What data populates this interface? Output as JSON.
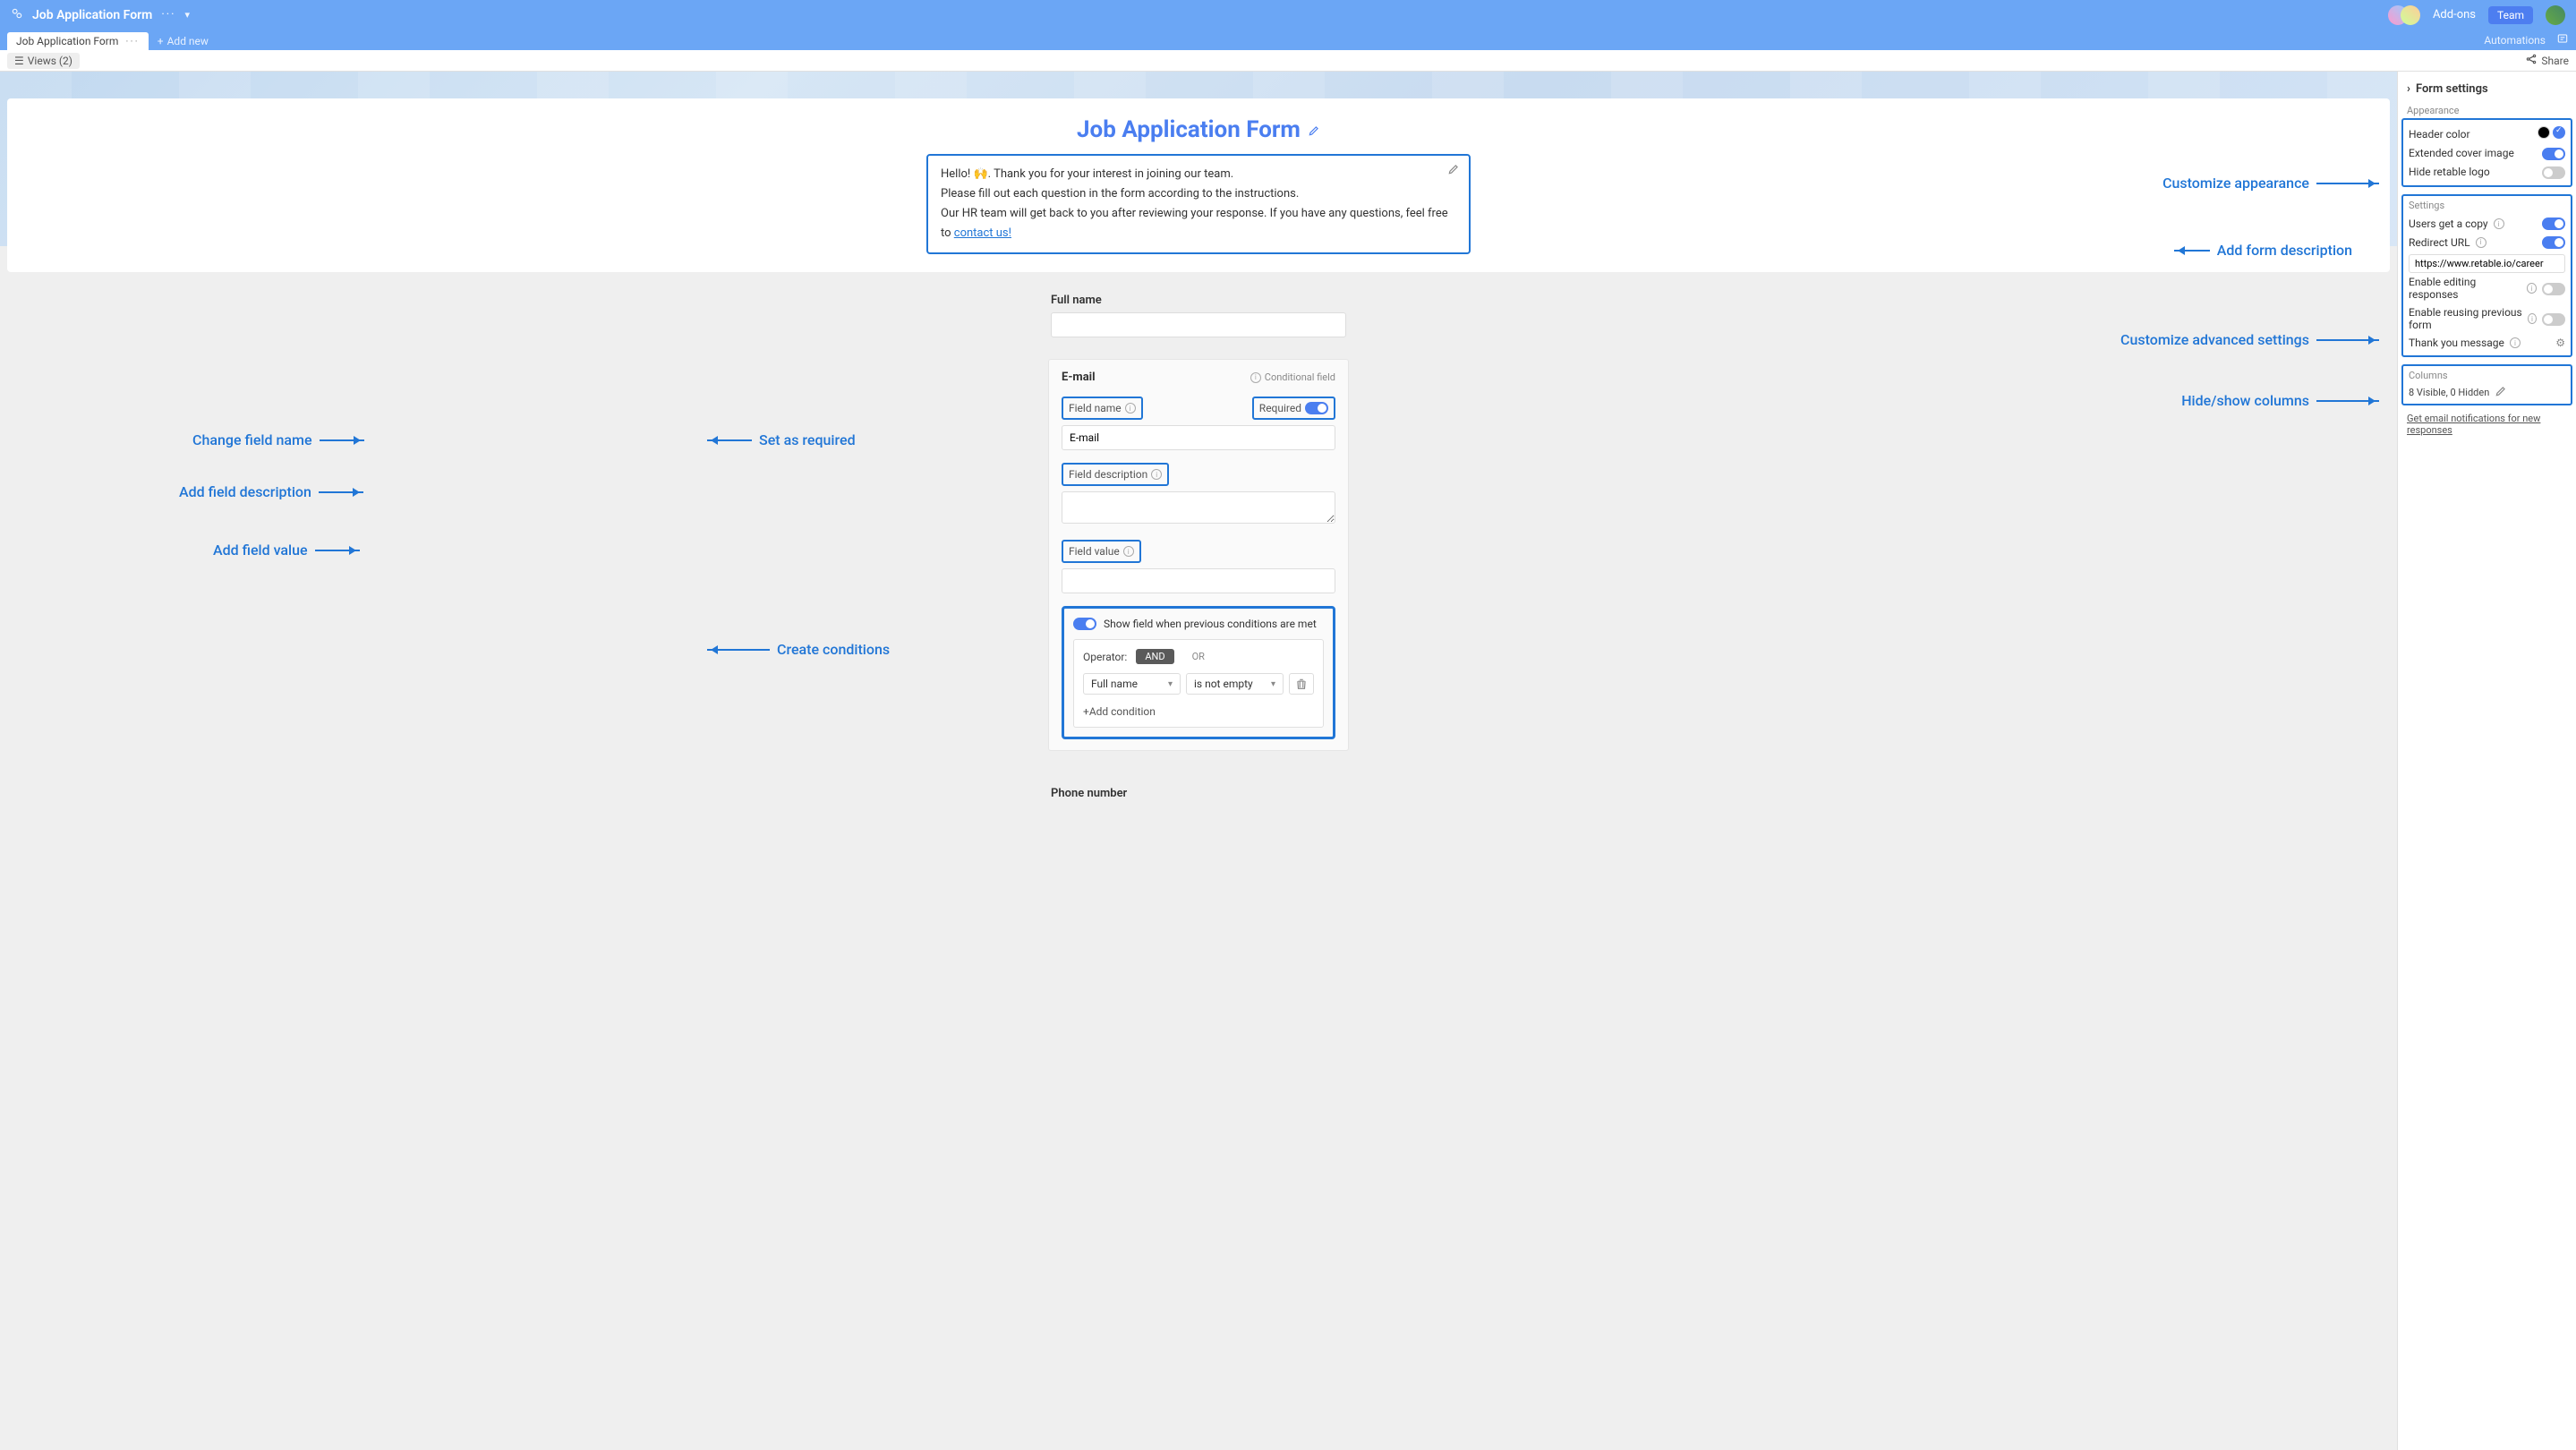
{
  "header": {
    "title": "Job Application Form",
    "addons": "Add-ons",
    "team": "Team"
  },
  "tabs": {
    "main": "Job Application Form",
    "add_new": "Add new",
    "automations": "Automations"
  },
  "viewsbar": {
    "views": "Views (2)",
    "share": "Share"
  },
  "form": {
    "title": "Job Application Form",
    "desc_line1_a": "Hello! ",
    "desc_line1_b": ". Thank you for your interest in joining our team.",
    "desc_line2": "Please fill out each question in the form according to the instructions.",
    "desc_line3_a": "Our HR team will get back to you after reviewing your response. If you have any questions, feel free to ",
    "desc_line3_link": "contact us!",
    "full_name_label": "Full name",
    "phone_label": "Phone number"
  },
  "editor": {
    "field_title": "E-mail",
    "conditional_field": "Conditional field",
    "field_name_label": "Field name",
    "required_label": "Required",
    "field_name_value": "E-mail",
    "field_desc_label": "Field description",
    "field_value_label": "Field value",
    "cond_show_label": "Show field when previous conditions are met",
    "operator_label": "Operator:",
    "op_and": "AND",
    "op_or": "OR",
    "crit_field": "Full name",
    "crit_op": "is not empty",
    "add_condition": "Add condition"
  },
  "callouts": {
    "change_field_name": "Change field name",
    "add_field_desc": "Add field description",
    "add_field_value": "Add field value",
    "set_required": "Set as required",
    "create_conditions": "Create conditions",
    "add_form_desc": "Add form description",
    "customize_appearance": "Customize appearance",
    "customize_settings": "Customize advanced settings",
    "hide_show_columns": "Hide/show columns"
  },
  "sidebar": {
    "title": "Form settings",
    "appearance_title": "Appearance",
    "header_color": "Header color",
    "extended_cover": "Extended cover image",
    "hide_logo": "Hide retable logo",
    "settings_title": "Settings",
    "users_copy": "Users get a copy",
    "redirect_url": "Redirect URL",
    "redirect_value": "https://www.retable.io/career",
    "enable_edit": "Enable editing responses",
    "enable_reuse": "Enable reusing previous form",
    "thank_you": "Thank you message",
    "columns_title": "Columns",
    "columns_count": "8 Visible, 0 Hidden",
    "email_notif": "Get email notifications for new responses"
  }
}
